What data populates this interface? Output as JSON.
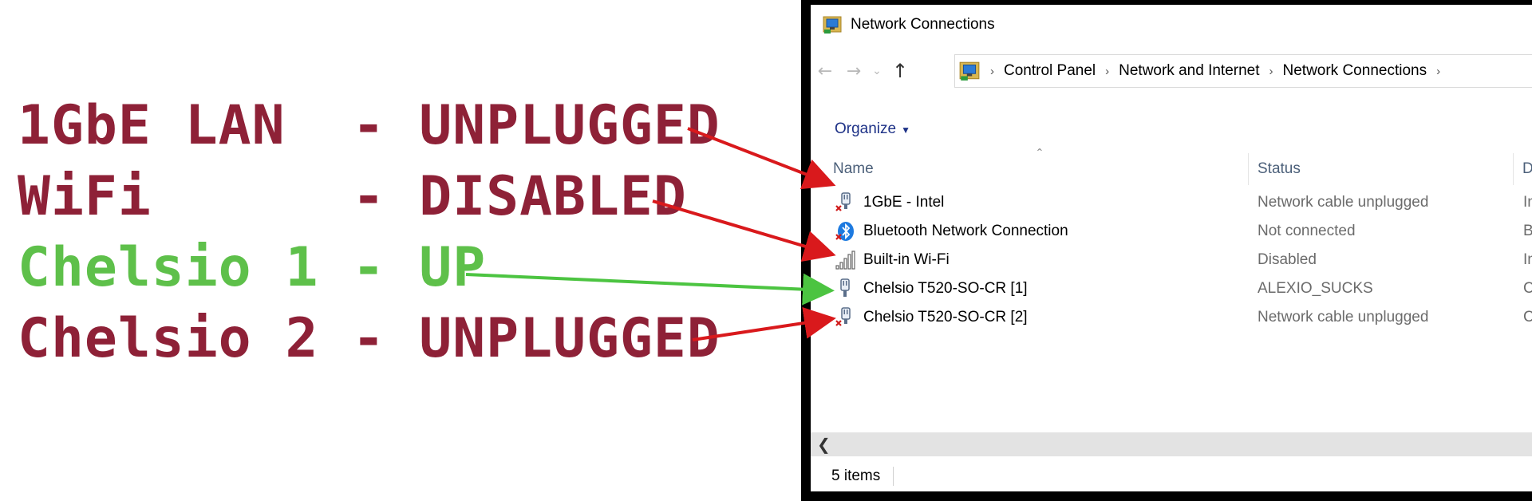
{
  "annotations": [
    {
      "text": "1GbE LAN  - UNPLUGGED",
      "color": "#8e2137"
    },
    {
      "text": "WiFi      - DISABLED",
      "color": "#8e2137"
    },
    {
      "text": "Chelsio 1 - UP",
      "color": "#5ec04a"
    },
    {
      "text": "Chelsio 2 - UNPLUGGED",
      "color": "#8e2137"
    }
  ],
  "arrow_colors": {
    "red": "#d9191c",
    "green": "#4cc441"
  },
  "window": {
    "title": "Network Connections",
    "title_icon": "network-connections-icon"
  },
  "nav": {
    "back": "←",
    "forward": "→",
    "recent": "⌄",
    "up": "↑",
    "location_icon": "network-folder-icon",
    "breadcrumbs": [
      "Control Panel",
      "Network and Internet",
      "Network Connections"
    ]
  },
  "toolbar": {
    "organize_label": "Organize"
  },
  "columns": {
    "name": "Name",
    "status": "Status",
    "device": "D"
  },
  "connections": [
    {
      "name": "1GbE - Intel",
      "status": "Network cable unplugged",
      "device": "In",
      "icon": "ethernet-disconnected-icon"
    },
    {
      "name": "Bluetooth Network Connection",
      "status": "Not connected",
      "device": "B",
      "icon": "bluetooth-icon"
    },
    {
      "name": "Built-in Wi-Fi",
      "status": "Disabled",
      "device": "In",
      "icon": "wifi-bars-icon"
    },
    {
      "name": "Chelsio T520-SO-CR [1]",
      "status": "ALEXIO_SUCKS",
      "device": "C",
      "icon": "ethernet-connected-icon"
    },
    {
      "name": "Chelsio T520-SO-CR [2]",
      "status": "Network cable unplugged",
      "device": "C",
      "icon": "ethernet-disconnected-icon"
    }
  ],
  "statusbar": {
    "item_count": "5 items"
  }
}
